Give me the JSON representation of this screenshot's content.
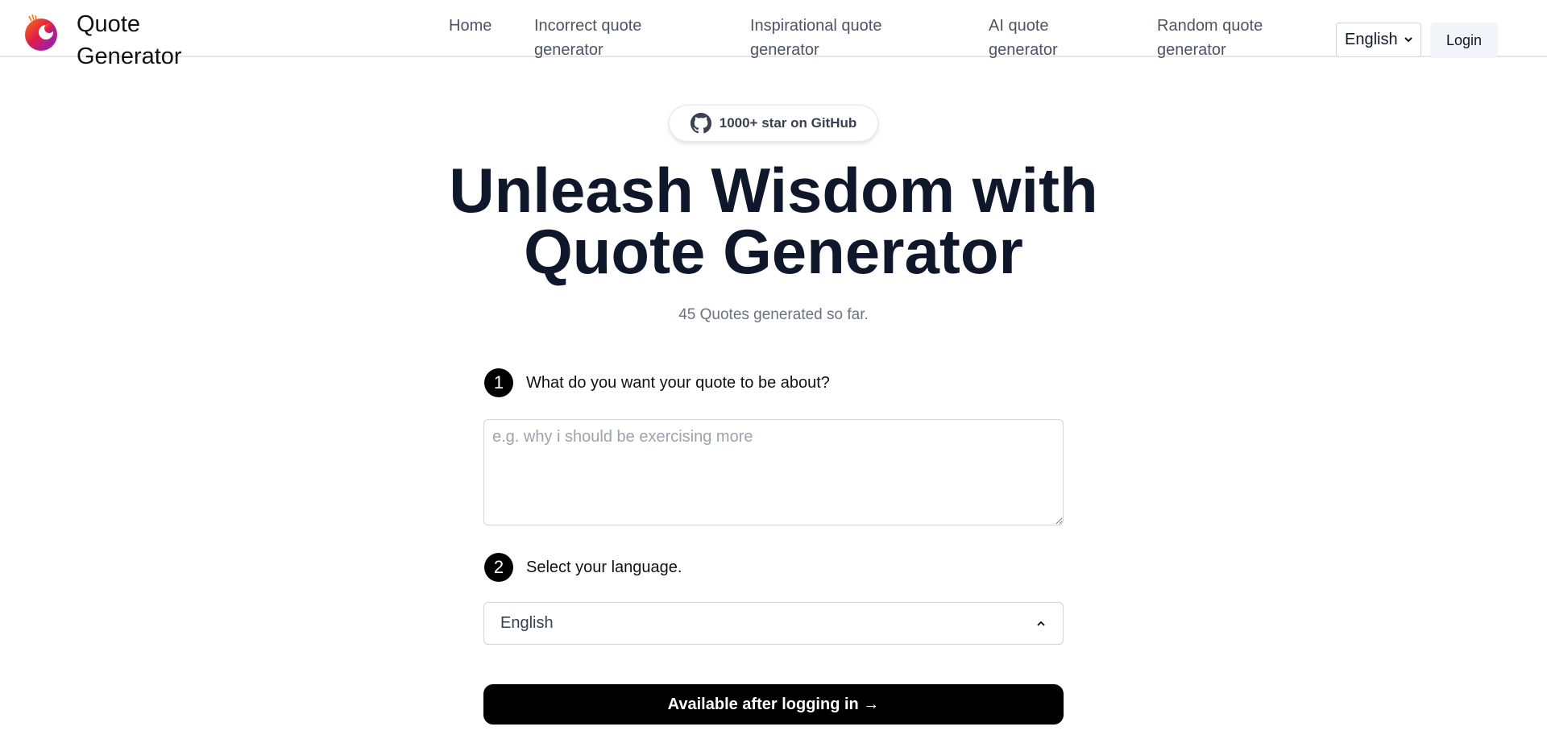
{
  "header": {
    "brand": "Quote Generator",
    "logo_icon": "phoenix-logo-icon",
    "nav": [
      {
        "label": "Home"
      },
      {
        "label": "Incorrect quote generator"
      },
      {
        "label": "Inspirational quote generator"
      },
      {
        "label": "AI quote generator"
      },
      {
        "label": "Random quote generator"
      }
    ],
    "language_select": {
      "value": "English",
      "icon": "chevron-down-icon"
    },
    "login_label": "Login"
  },
  "hero": {
    "github_badge": {
      "label": "1000+ star on GitHub",
      "icon": "github-icon"
    },
    "title_line1": "Unleash Wisdom with",
    "title_line2": "Quote Generator",
    "counter": "45 Quotes generated so far."
  },
  "form": {
    "step1": {
      "number": "1",
      "label": "What do you want your quote to be about?"
    },
    "topic_input": {
      "value": "",
      "placeholder": "e.g. why i should be exercising more"
    },
    "step2": {
      "number": "2",
      "label": "Select your language."
    },
    "language": {
      "value": "English",
      "icon": "chevron-up-icon"
    },
    "submit_label": "Available after logging in →"
  },
  "colors": {
    "title": "#0f172a",
    "button_bg": "#000000",
    "login_bg": "#f1f5f9",
    "muted_text": "#6b7280"
  }
}
